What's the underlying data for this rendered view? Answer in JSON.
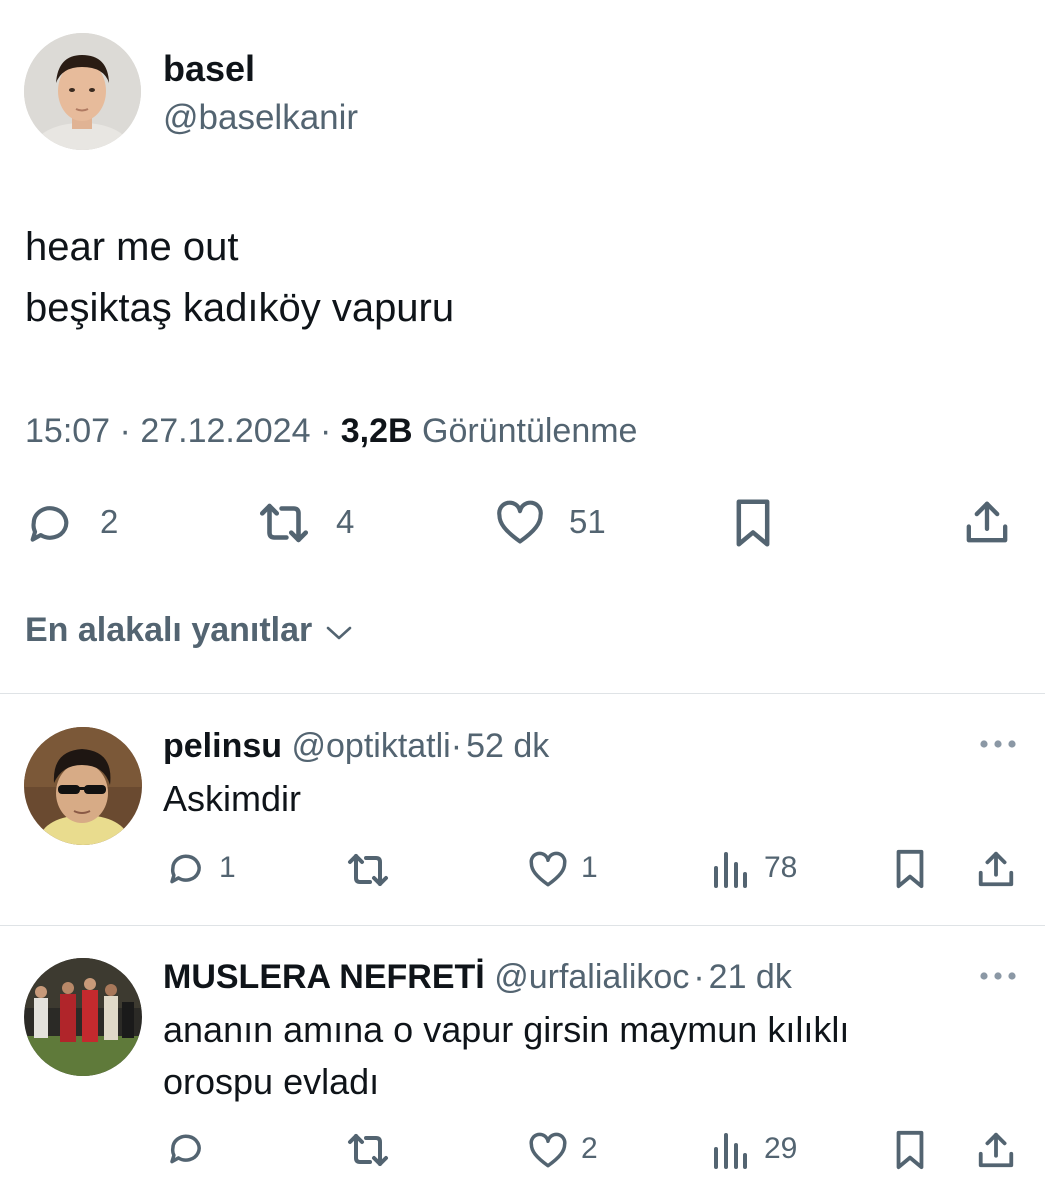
{
  "tweet": {
    "author_name": "basel",
    "author_handle": "@baselkanir",
    "text_line1": "hear me out",
    "text_line2": "beşiktaş kadıköy vapuru",
    "time": "15:07",
    "date": "27.12.2024",
    "sep": "·",
    "views_count": "3,2B",
    "views_label": "Görüntülenme",
    "actions": {
      "reply_count": "2",
      "retweet_count": "4",
      "like_count": "51"
    }
  },
  "sort": {
    "label": "En alakalı yanıtlar"
  },
  "replies": [
    {
      "name": "pelinsu",
      "handle": "@optiktatli",
      "sep": "·",
      "time": "52 dk",
      "text": "Askimdir",
      "reply_count": "1",
      "like_count": "1",
      "views": "78"
    },
    {
      "name": "MUSLERA NEFRETİ",
      "handle": "@urfalialikoc",
      "sep": "·",
      "time": "21 dk",
      "text_line1": "ananın amına o vapur girsin maymun kılıklı",
      "text_line2": "orospu evladı",
      "like_count": "2",
      "views": "29"
    }
  ],
  "colors": {
    "primary": "#0f1419",
    "secondary": "#536471",
    "divider": "#dfe3e6"
  }
}
